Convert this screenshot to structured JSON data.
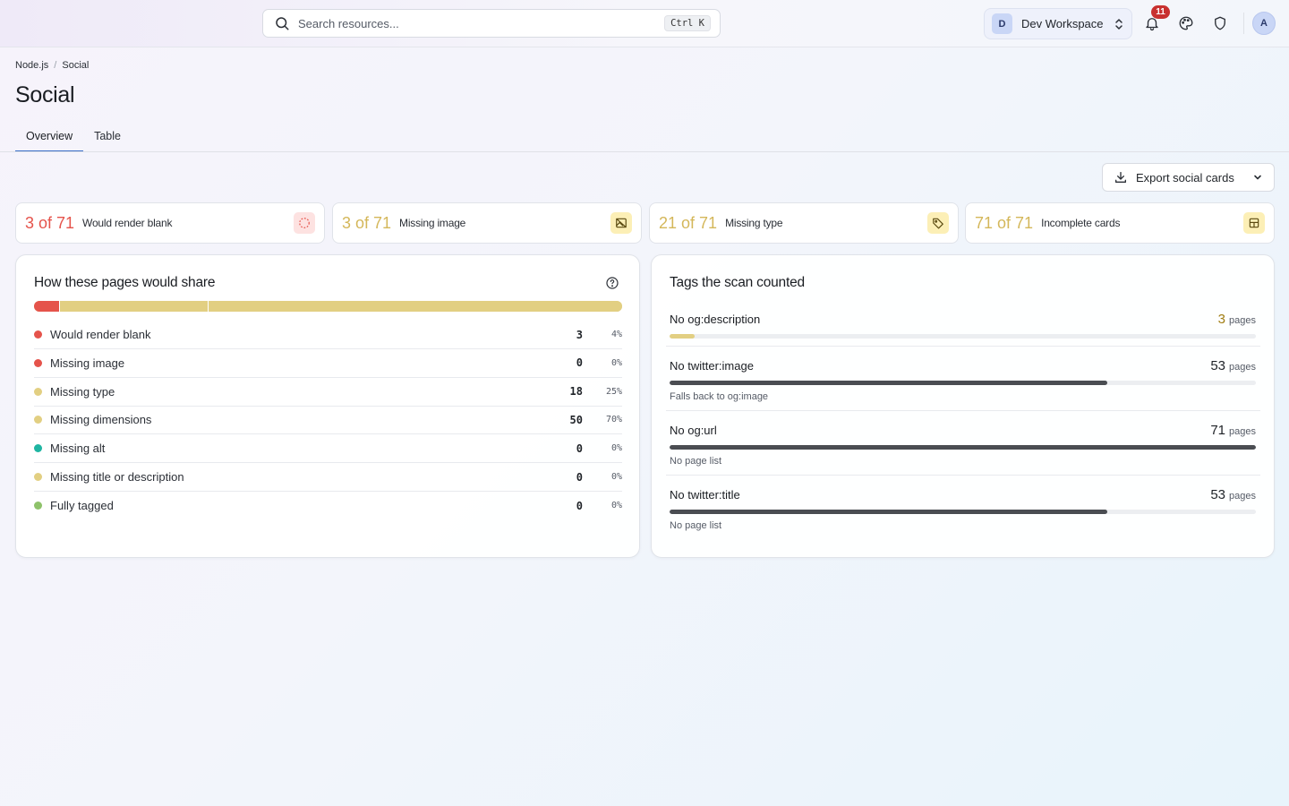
{
  "header": {
    "search_placeholder": "Search resources...",
    "search_shortcut": "Ctrl K",
    "workspace_initial": "D",
    "workspace_name": "Dev Workspace",
    "notification_count": "11",
    "avatar_initial": "A"
  },
  "breadcrumb": {
    "parent": "Node.js",
    "separator": "/",
    "current": "Social"
  },
  "page": {
    "title": "Social"
  },
  "tabs": [
    {
      "label": "Overview"
    },
    {
      "label": "Table"
    }
  ],
  "export": {
    "label": "Export social cards"
  },
  "stats": [
    {
      "value": "3 of 71",
      "label": "Would render blank",
      "color": "#e5534b",
      "icon_bg": "#fde2e1",
      "icon": "dashed-circle-icon"
    },
    {
      "value": "3 of 71",
      "label": "Missing image",
      "color": "#d4b75a",
      "icon_bg": "#fcefb6",
      "icon": "image-off-icon"
    },
    {
      "value": "21 of 71",
      "label": "Missing type",
      "color": "#d4b75a",
      "icon_bg": "#fcefb6",
      "icon": "tag-icon"
    },
    {
      "value": "71 of 71",
      "label": "Incomplete cards",
      "color": "#d4b75a",
      "icon_bg": "#fcefb6",
      "icon": "layout-icon"
    }
  ],
  "share": {
    "title": "How these pages would share",
    "rows": [
      {
        "label": "Would render blank",
        "count": "3",
        "pct": "4%",
        "color": "#e5534b"
      },
      {
        "label": "Missing image",
        "count": "0",
        "pct": "0%",
        "color": "#e5534b"
      },
      {
        "label": "Missing type",
        "count": "18",
        "pct": "25%",
        "color": "#e2cf82"
      },
      {
        "label": "Missing dimensions",
        "count": "50",
        "pct": "70%",
        "color": "#e2cf82"
      },
      {
        "label": "Missing alt",
        "count": "0",
        "pct": "0%",
        "color": "#1fb5a2"
      },
      {
        "label": "Missing title or description",
        "count": "0",
        "pct": "0%",
        "color": "#e2cf82"
      },
      {
        "label": "Fully tagged",
        "count": "0",
        "pct": "0%",
        "color": "#8ec26a"
      }
    ]
  },
  "tags": {
    "title": "Tags the scan counted",
    "unit": "pages",
    "items": [
      {
        "name": "No og:description",
        "count": "3",
        "fraction": 0.042,
        "note": "",
        "count_color": "#a07d12",
        "bar_color": "#e2cf82"
      },
      {
        "name": "No twitter:image",
        "count": "53",
        "fraction": 0.746,
        "note": "Falls back to og:image",
        "count_color": "#1f2328",
        "bar_color": "#4a4d52"
      },
      {
        "name": "No og:url",
        "count": "71",
        "fraction": 1.0,
        "note": "No page list",
        "count_color": "#1f2328",
        "bar_color": "#4a4d52"
      },
      {
        "name": "No twitter:title",
        "count": "53",
        "fraction": 0.746,
        "note": "No page list",
        "count_color": "#1f2328",
        "bar_color": "#4a4d52"
      }
    ]
  }
}
